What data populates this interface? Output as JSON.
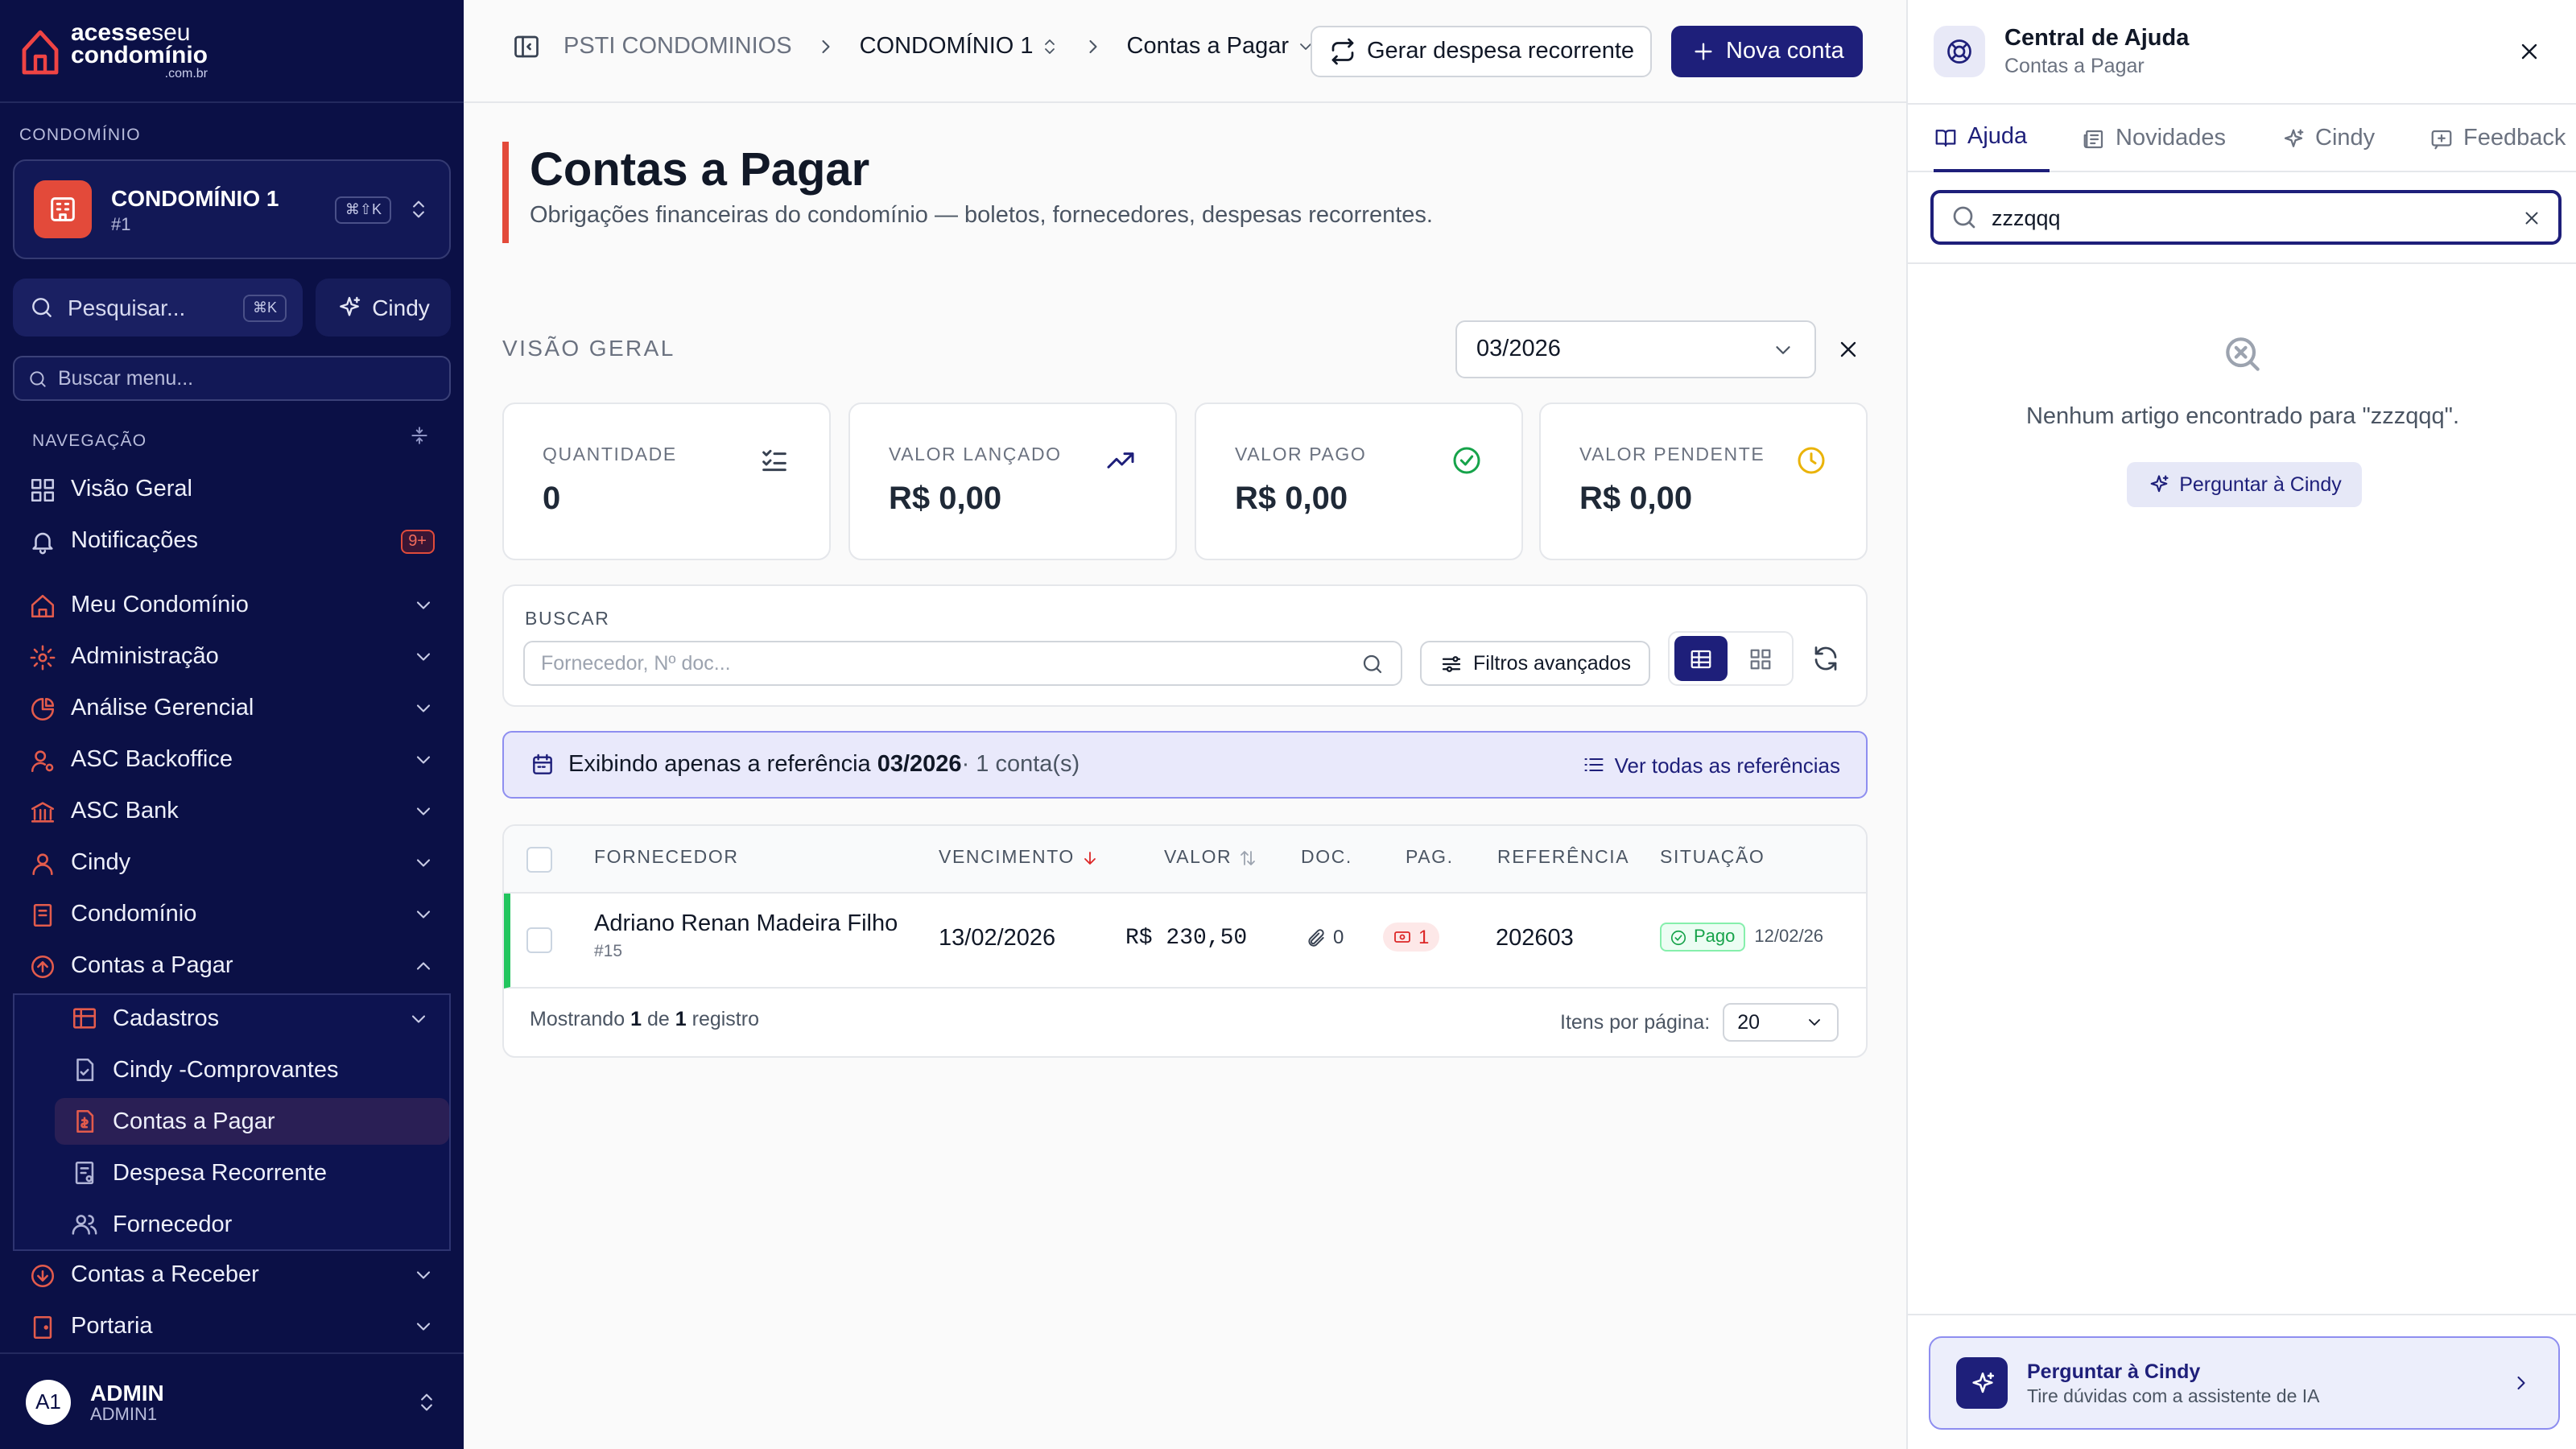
{
  "sidebar": {
    "logo_line1": "acesse",
    "logo_line1b": "seu",
    "logo_line2": "condomínio",
    "logo_domain": ".com.br",
    "section_condo": "CONDOMÍNIO",
    "condo_name": "CONDOMÍNIO 1",
    "condo_number": "#1",
    "condo_shortcut": "⌘⇧K",
    "search_label": "Pesquisar...",
    "search_shortcut": "⌘K",
    "cindy_label": "Cindy",
    "menu_search_placeholder": "Buscar menu...",
    "nav_label": "NAVEGAÇÃO",
    "items": [
      {
        "label": "Visão Geral"
      },
      {
        "label": "Notificações",
        "badge": "9+"
      },
      {
        "label": "Meu Condomínio"
      },
      {
        "label": "Administração"
      },
      {
        "label": "Análise Gerencial"
      },
      {
        "label": "ASC Backoffice"
      },
      {
        "label": "ASC Bank"
      },
      {
        "label": "Cindy"
      },
      {
        "label": "Condomínio"
      },
      {
        "label": "Contas a Pagar"
      },
      {
        "label": "Contas a Receber"
      },
      {
        "label": "Portaria"
      }
    ],
    "sub_items": [
      {
        "label": "Cadastros"
      },
      {
        "label": "Cindy -Comprovantes"
      },
      {
        "label": "Contas a Pagar"
      },
      {
        "label": "Despesa Recorrente"
      },
      {
        "label": "Fornecedor"
      }
    ],
    "user": {
      "initials": "A1",
      "name": "ADMIN",
      "login": "ADMIN1"
    }
  },
  "topbar": {
    "breadcrumb": [
      "PSTI CONDOMINIOS",
      "CONDOMÍNIO 1",
      "Contas a Pagar"
    ],
    "recurring_label": "Gerar despesa recorrente",
    "new_label": "Nova conta"
  },
  "page": {
    "title": "Contas a Pagar",
    "subtitle": "Obrigações financeiras do condomínio — boletos, fornecedores, despesas recorrentes.",
    "overview_label": "VISÃO GERAL",
    "month": "03/2026"
  },
  "stats": [
    {
      "label": "QUANTIDADE",
      "value": "0",
      "color": "#374151"
    },
    {
      "label": "VALOR LANÇADO",
      "value": "R$ 0,00",
      "color": "#1e1f7a"
    },
    {
      "label": "VALOR PAGO",
      "value": "R$ 0,00",
      "color": "#16a34a"
    },
    {
      "label": "VALOR PENDENTE",
      "value": "R$ 0,00",
      "color": "#eab308"
    }
  ],
  "filter": {
    "label": "BUSCAR",
    "placeholder": "Fornecedor, Nº doc...",
    "advanced_label": "Filtros avançados"
  },
  "info_bar": {
    "prefix": "Exibindo apenas a referência",
    "reference": "03/2026",
    "count": "· 1 conta(s)",
    "link": "Ver todas as referências"
  },
  "table": {
    "headers": [
      "FORNECEDOR",
      "VENCIMENTO",
      "VALOR",
      "DOC.",
      "PAG.",
      "REFERÊNCIA",
      "SITUAÇÃO"
    ],
    "rows": [
      {
        "supplier": "Adriano Renan Madeira Filho",
        "id": "#15",
        "due": "13/02/2026",
        "value": "R$ 230,50",
        "docs": "0",
        "payments": "1",
        "reference": "202603",
        "status": "Pago",
        "status_date": "12/02/26"
      }
    ],
    "footer": {
      "prefix": "Mostrando",
      "shown": "1",
      "of": "de",
      "total": "1",
      "suffix": "registro"
    },
    "per_page_label": "Itens por página:",
    "per_page": "20"
  },
  "help": {
    "title": "Central de Ajuda",
    "subtitle": "Contas a Pagar",
    "tabs": [
      "Ajuda",
      "Novidades",
      "Cindy",
      "Feedback"
    ],
    "search_value": "zzzqqq",
    "empty_text": "Nenhum artigo encontrado para \"zzzqqq\".",
    "ask_label": "Perguntar à Cindy",
    "card_title": "Perguntar à Cindy",
    "card_sub": "Tire dúvidas com a assistente de IA"
  }
}
